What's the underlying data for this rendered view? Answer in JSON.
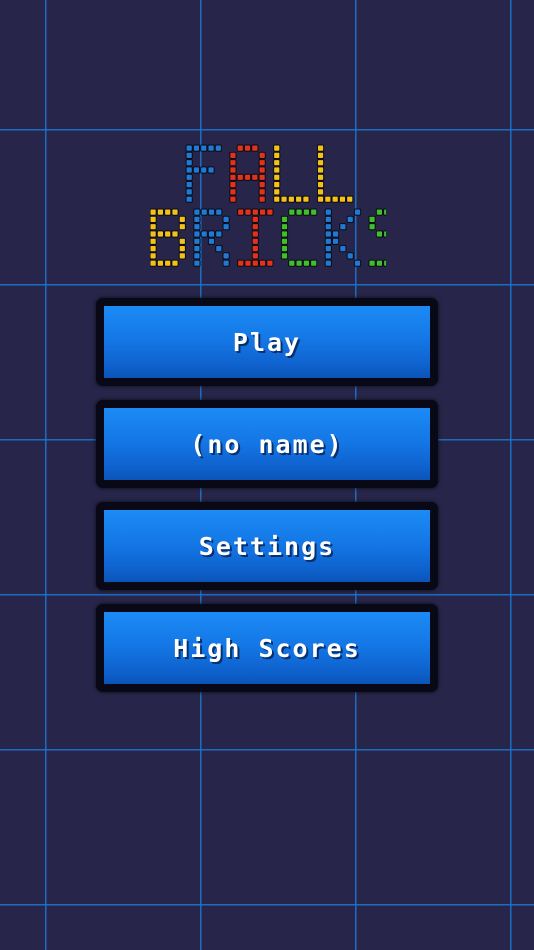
{
  "logo": {
    "line1": "FALL",
    "line2": "BRICKS",
    "colors": {
      "yellow": "#f2c21a",
      "blue": "#1f7ad6",
      "red": "#e3321c",
      "green": "#3fbf2a",
      "outline": "#0a0a14"
    }
  },
  "menu": {
    "play_label": "Play",
    "name_label": "(no name)",
    "settings_label": "Settings",
    "high_scores_label": "High Scores"
  },
  "theme": {
    "background": "#27264a",
    "grid_line": "#1978d7",
    "button_top": "#1c8bf5",
    "button_bottom": "#0b54b8",
    "button_border": "#080816"
  }
}
